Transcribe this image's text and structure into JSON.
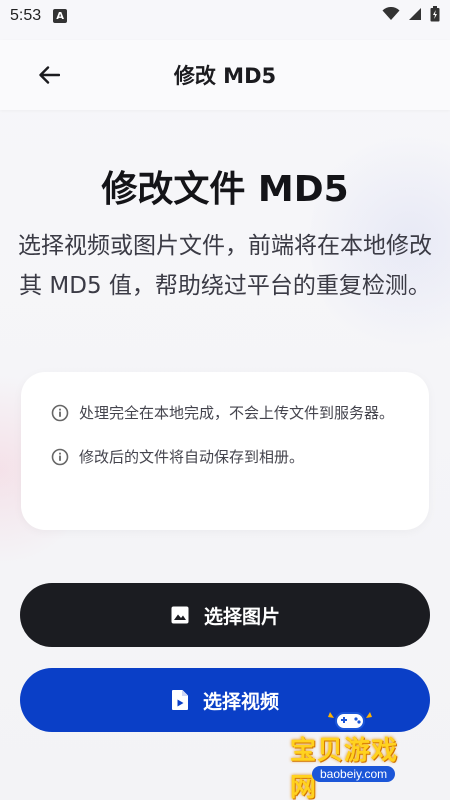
{
  "status_bar": {
    "time": "5:53",
    "a_badge": "A"
  },
  "app_bar": {
    "title": "修改 MD5"
  },
  "main": {
    "headline": "修改文件 MD5",
    "description": "选择视频或图片文件，前端将在本地修改其 MD5 值，帮助绕过平台的重复检测。",
    "info": [
      "处理完全在本地完成，不会上传文件到服务器。",
      "修改后的文件将自动保存到相册。"
    ],
    "buttons": {
      "select_image": "选择图片",
      "select_video": "选择视频"
    }
  },
  "watermark": {
    "name": "宝贝游戏网",
    "url": "baobeiy.com"
  },
  "colors": {
    "dark_button": "#1b1c21",
    "primary_button": "#0a3fc7",
    "watermark_yellow": "#ffd21f"
  }
}
